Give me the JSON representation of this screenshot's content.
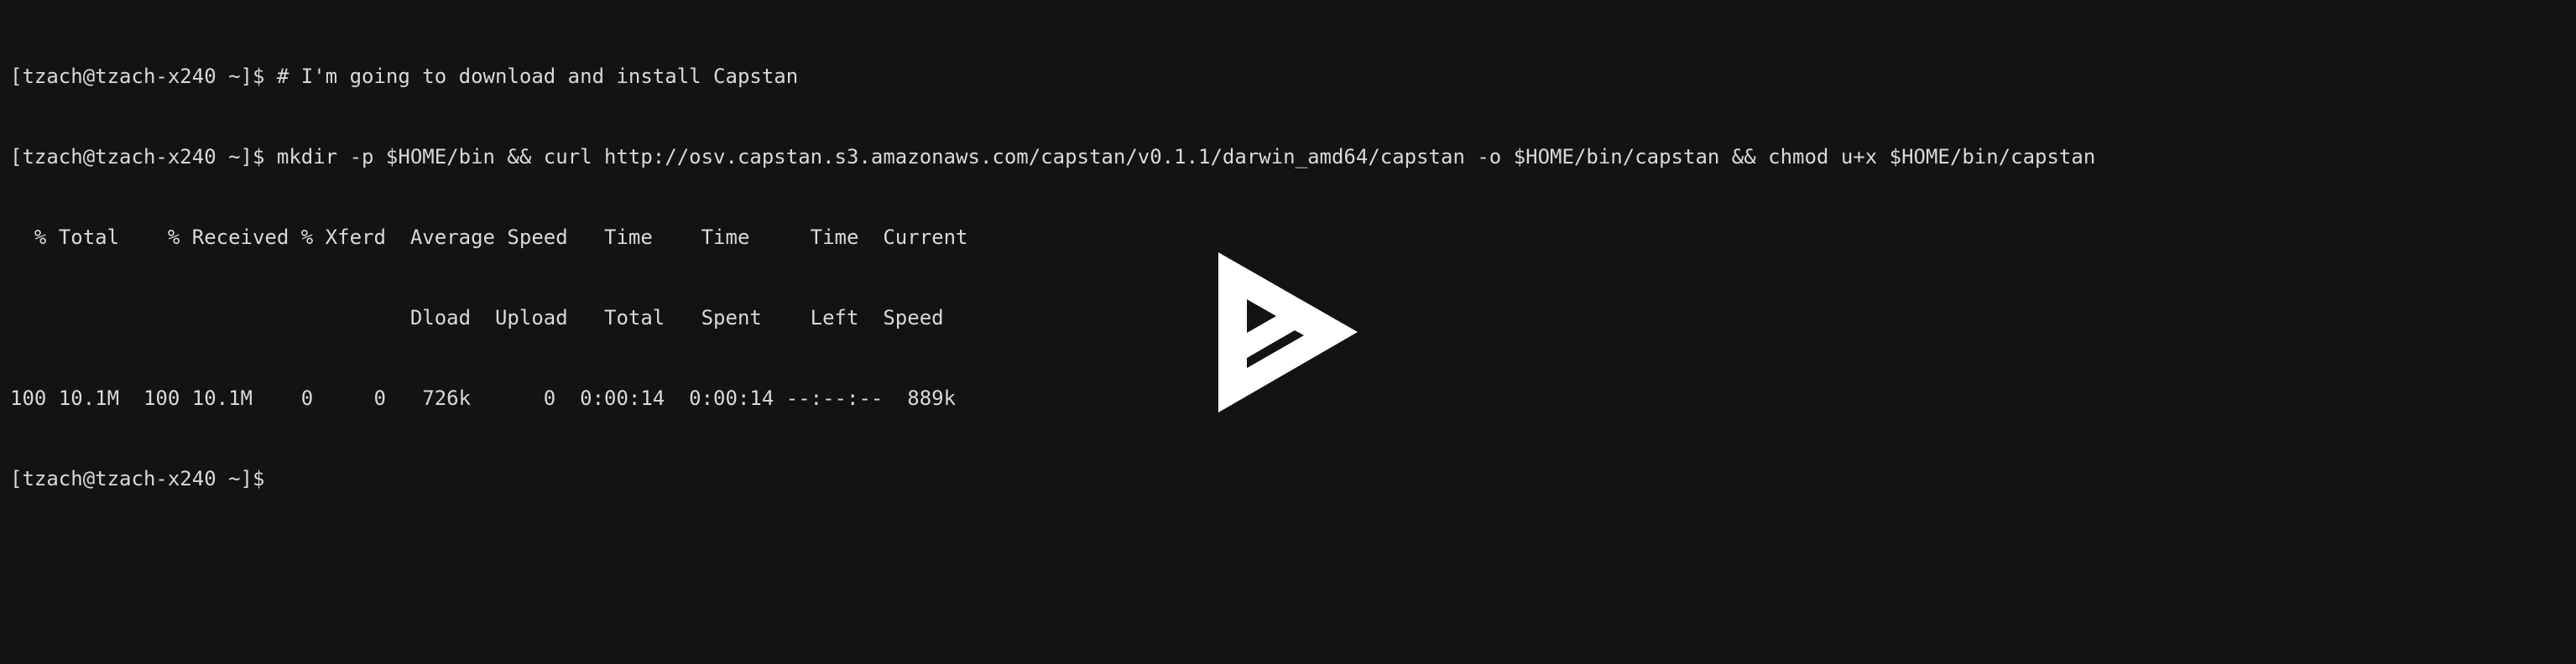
{
  "terminal": {
    "lines": [
      "[tzach@tzach-x240 ~]$ # I'm going to download and install Capstan",
      "[tzach@tzach-x240 ~]$ mkdir -p $HOME/bin && curl http://osv.capstan.s3.amazonaws.com/capstan/v0.1.1/darwin_amd64/capstan -o $HOME/bin/capstan && chmod u+x $HOME/bin/capstan",
      "  % Total    % Received % Xferd  Average Speed   Time    Time     Time  Current",
      "                                 Dload  Upload   Total   Spent    Left  Speed",
      "100 10.1M  100 10.1M    0     0   726k      0  0:00:14  0:00:14 --:--:--  889k",
      "[tzach@tzach-x240 ~]$"
    ]
  },
  "overlay": {
    "icon": "play-icon",
    "icon_color": "#ffffff"
  },
  "colors": {
    "background": "#121314",
    "text": "#d9d9d9"
  }
}
